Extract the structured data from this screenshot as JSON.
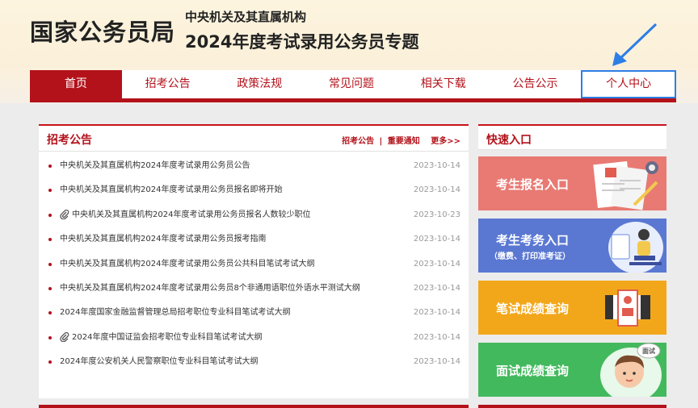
{
  "header": {
    "site_name": "国家公务员局",
    "subtitle_line1": "中央机关及其直属机构",
    "subtitle_line2": "2024年度考试录用公务员专题"
  },
  "nav": {
    "items": [
      "首页",
      "招考公告",
      "政策法规",
      "常见问题",
      "相关下载",
      "公告公示",
      "个人中心"
    ]
  },
  "notices": {
    "title": "招考公告",
    "link_a": "招考公告",
    "sep": "|",
    "link_b": "重要通知",
    "more": "更多>>",
    "items": [
      {
        "text": "中央机关及其直属机构2024年度考试录用公务员公告",
        "date": "2023-10-14"
      },
      {
        "text": "中央机关及其直属机构2024年度考试录用公务员报名即将开始",
        "date": "2023-10-14"
      },
      {
        "text": "中央机关及其直属机构2024年度考试录用公务员报名人数较少职位",
        "date": "2023-10-23"
      },
      {
        "text": "中央机关及其直属机构2024年度考试录用公务员报考指南",
        "date": "2023-10-14"
      },
      {
        "text": "中央机关及其直属机构2024年度考试录用公务员公共科目笔试考试大纲",
        "date": "2023-10-14"
      },
      {
        "text": "中央机关及其直属机构2024年度考试录用公务员8个非通用语职位外语水平测试大纲",
        "date": "2023-10-14"
      },
      {
        "text": "2024年度国家金融监督管理总局招考职位专业科目笔试考试大纲",
        "date": "2023-10-14"
      },
      {
        "text": "2024年度中国证监会招考职位专业科目笔试考试大纲",
        "date": "2023-10-14"
      },
      {
        "text": "2024年度公安机关人民警察职位专业科目笔试考试大纲",
        "date": "2023-10-14"
      }
    ]
  },
  "quick": {
    "title": "快速入口",
    "register": "考生报名入口",
    "exam_affairs": "考生考务入口",
    "exam_affairs_sub": "（缴费、打印准考证）",
    "written_score": "笔试成绩查询",
    "interview_score": "面试成绩查询",
    "interview_badge": "面试"
  },
  "colors": {
    "brand_red": "#b3121b",
    "highlight_blue": "#2d7ee6"
  }
}
